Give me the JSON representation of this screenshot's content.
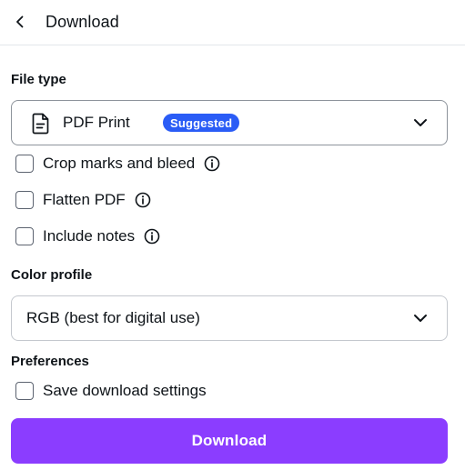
{
  "header": {
    "title": "Download"
  },
  "file_type": {
    "label": "File type",
    "selected": "PDF Print",
    "badge": "Suggested",
    "options": [
      {
        "id": "crop",
        "label": "Crop marks and bleed",
        "checked": false,
        "has_info": true
      },
      {
        "id": "flatten",
        "label": "Flatten PDF",
        "checked": false,
        "has_info": true
      },
      {
        "id": "notes",
        "label": "Include notes",
        "checked": false,
        "has_info": true
      }
    ]
  },
  "color_profile": {
    "label": "Color profile",
    "selected": "RGB (best for digital use)"
  },
  "preferences": {
    "label": "Preferences",
    "save_settings_label": "Save download settings",
    "save_settings_checked": false
  },
  "download_button": {
    "label": "Download"
  },
  "colors": {
    "accent": "#8b3dff",
    "badge": "#2a5cf6",
    "text": "#0e1318",
    "border": "#c4c8ce"
  },
  "icons": {
    "back": "chevron-left-icon",
    "file": "file-document-icon",
    "dropdown": "chevron-down-icon",
    "info": "info-icon"
  }
}
